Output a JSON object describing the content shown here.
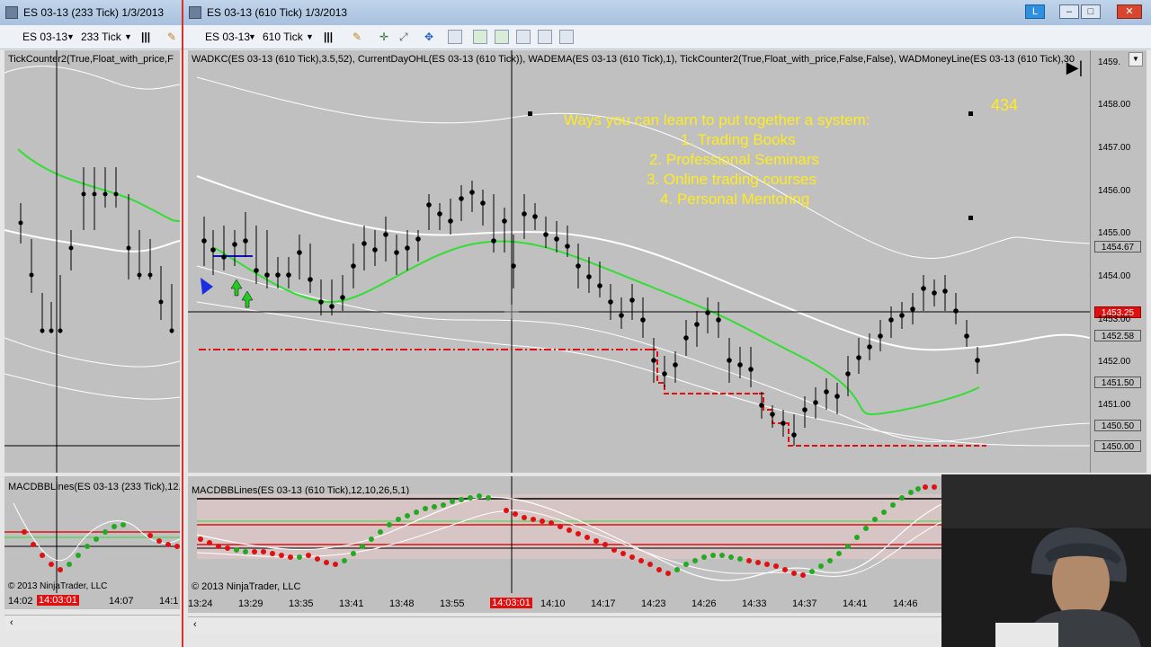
{
  "left_window": {
    "title": "ES 03-13 (233 Tick)  1/3/2013",
    "instrument": "ES 03-13",
    "interval": "233 Tick",
    "indicator_label": "TickCounter2(True,Float_with_price,F",
    "macd_label": "MACDBBLines(ES 03-13 (233 Tick),12,",
    "copyright": "© 2013 NinjaTrader, LLC",
    "time_labels": [
      "14:02",
      "14:03:01",
      "14:07",
      "14:1"
    ]
  },
  "main_window": {
    "title": "ES 03-13 (610 Tick)  1/3/2013",
    "instrument": "ES 03-13",
    "interval": "610 Tick",
    "indicator_label": "WADKC(ES 03-13 (610 Tick),3.5,52), CurrentDayOHL(ES 03-13 (610 Tick)), WADEMA(ES 03-13 (610 Tick),1), TickCounter2(True,Float_with_price,False,False), WADMoneyLine(ES 03-13 (610 Tick),30",
    "macd_label": "MACDBBLines(ES 03-13 (610 Tick),12,10,26,5,1)",
    "copyright": "© 2013 NinjaTrader, LLC",
    "tick_counter": "434",
    "caps_button": "L",
    "overlay_lines": [
      "Ways you can learn to put together a system:",
      "1. Trading Books",
      "2. Professional Seminars",
      "3. Online trading courses",
      "4. Personal Mentoring"
    ],
    "price_axis": [
      "1459.",
      "1458.00",
      "1457.00",
      "1456.00",
      "1455.00",
      "1454.67",
      "1454.00",
      "1453.25",
      "1453.00",
      "1452.58",
      "1452.00",
      "1451.50",
      "1451.00",
      "1450.50",
      "1450.00"
    ],
    "time_axis": [
      "13:24",
      "13:29",
      "13:35",
      "13:41",
      "13:48",
      "13:55",
      "14:03:01",
      "14:10",
      "14:17",
      "14:23",
      "14:26",
      "14:33",
      "14:37",
      "14:41",
      "14:46"
    ],
    "current_price": "1453.25",
    "cursor_time": "14:03:01"
  },
  "colors": {
    "chart_bg": "#c0c0c0",
    "bar": "#000000",
    "ema": "#33dd33",
    "bands": "#ffffff",
    "ohl_line": "#e01010",
    "overlay_text": "#ffeb20",
    "accent": "#2f8fe0"
  },
  "icons": [
    "window-icon",
    "minimize-icon",
    "maximize-icon",
    "close-icon",
    "bar-type-icon",
    "draw-pencil-icon",
    "crosshair-icon",
    "zoom-icon",
    "properties-icon",
    "scroll-end-icon",
    "buy-arrow-icon",
    "sell-arrow-icon"
  ]
}
